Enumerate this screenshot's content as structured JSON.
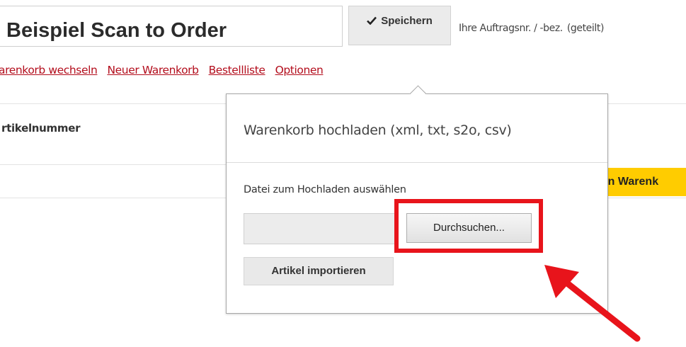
{
  "header": {
    "cart_name": "Beispiel Scan to Order",
    "save_label": "Speichern",
    "order_ref_label": "Ihre Auftragsnr. / -bez.",
    "shared_label": "(geteilt)"
  },
  "nav": {
    "links": [
      "arenkorb wechseln",
      "Neuer Warenkorb",
      "Bestellliste",
      "Optionen"
    ]
  },
  "table": {
    "column_header": "rtikelnummer"
  },
  "yellow_button_label": "den Warenk",
  "upload_popover": {
    "title": "Warenkorb hochladen (xml, txt, s2o, csv)",
    "file_label": "Datei zum Hochladen auswählen",
    "browse_label": "Durchsuchen...",
    "import_label": "Artikel importieren"
  },
  "icons": {
    "save": "check-icon",
    "annotation": "red-arrow-icon"
  },
  "colors": {
    "link": "#b30d1c",
    "highlight": "#e8141b",
    "yellow_button": "#ffcc00"
  }
}
